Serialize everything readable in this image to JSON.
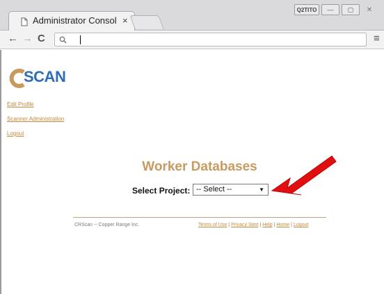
{
  "browser": {
    "tab_title": "Administrator Consol",
    "tab_close": "×",
    "user_badge": "Q2TITO",
    "min": "—",
    "max": "▢",
    "close": "✕",
    "back": "←",
    "forward": "→",
    "reload": "C",
    "omnibox_icon": "🔍",
    "omnibox_value": "",
    "menu": "≡"
  },
  "page": {
    "logo_text": "SCAN",
    "side_links": [
      "Edit Profile",
      "Scanner Administration",
      "Logout"
    ],
    "title": "Worker Databases",
    "select_label": "Select Project:",
    "select_value": "-- Select --",
    "select_arrow": "▼",
    "footer_left": "CRScan -- Copper Range Inc.",
    "footer_links": [
      "Terms of Use",
      "Privacy Stmt",
      "Help",
      "Home",
      "Logout"
    ],
    "footer_sep": "|"
  },
  "colors": {
    "accent_tan": "#c89a5e",
    "link": "#c8883a",
    "logo_blue": "#2e6db4",
    "arrow_red": "#e01010"
  }
}
